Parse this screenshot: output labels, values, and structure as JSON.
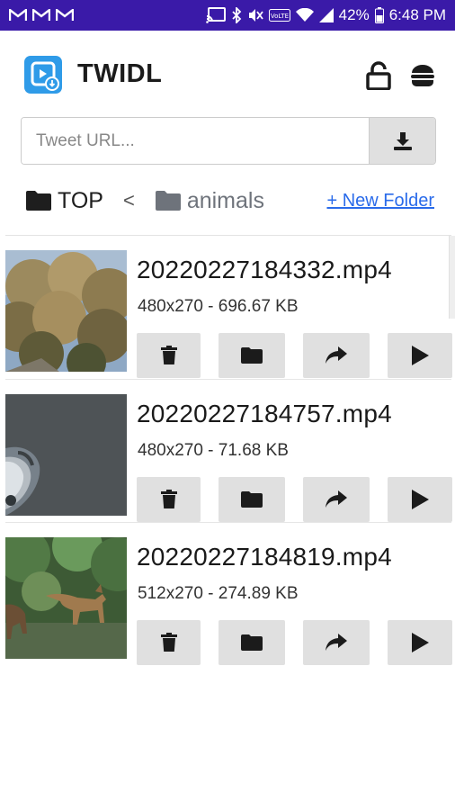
{
  "status_bar": {
    "battery": "42%",
    "time": "6:48 PM",
    "background_color": "#3a1aa8"
  },
  "app": {
    "title": "TWIDL",
    "logo_color": "#2f9be8"
  },
  "url_bar": {
    "placeholder": "Tweet URL...",
    "value": ""
  },
  "breadcrumb": {
    "root_label": "TOP",
    "separator": "<",
    "current_label": "animals",
    "new_folder_label": "+ New Folder",
    "link_color": "#2a6bea"
  },
  "files": [
    {
      "name": "20220227184332.mp4",
      "meta": "480x270 - 696.67 KB",
      "thumb": "trees"
    },
    {
      "name": "20220227184757.mp4",
      "meta": "480x270 - 71.68 KB",
      "thumb": "dark"
    },
    {
      "name": "20220227184819.mp4",
      "meta": "512x270 - 274.89 KB",
      "thumb": "animals"
    }
  ],
  "file_actions": [
    "trash-icon",
    "folder-icon",
    "share-icon",
    "play-icon"
  ]
}
